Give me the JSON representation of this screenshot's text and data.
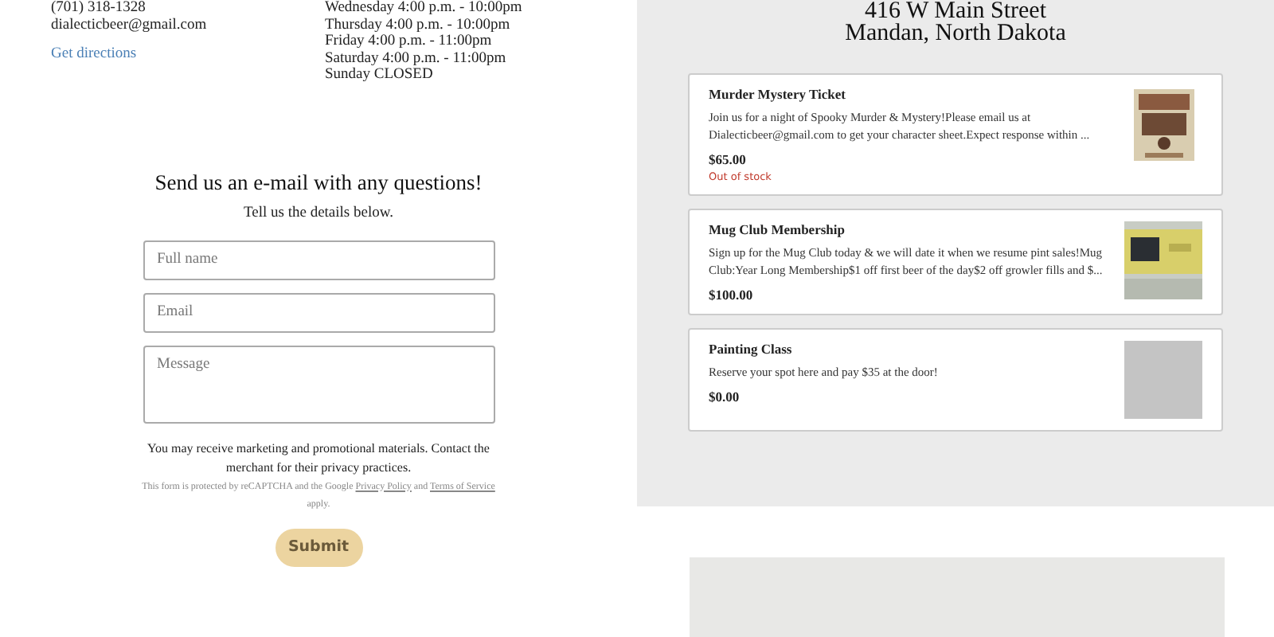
{
  "contact": {
    "phone": "(701) 318-1328",
    "email": "dialecticbeer@gmail.com",
    "directions_link": "Get directions"
  },
  "hours": [
    "Wednesday 4:00 p.m. - 10:00pm",
    "Thursday 4:00 p.m. - 10:00pm",
    "Friday 4:00 p.m. - 11:00pm",
    "Saturday 4:00 p.m. - 11:00pm",
    "Sunday CLOSED"
  ],
  "form": {
    "heading": "Send us an e-mail with any questions!",
    "subheading": "Tell us the details below.",
    "fields": [
      {
        "kind": "line",
        "placeholder": "Full name"
      },
      {
        "kind": "line",
        "placeholder": "Email"
      },
      {
        "kind": "area",
        "placeholder": "Message"
      }
    ],
    "consent": "You may receive marketing and promotional materials. Contact the merchant for their privacy practices.",
    "recaptcha": {
      "before": "This form is protected by reCAPTCHA and the Google",
      "privacy_link": "Privacy Policy",
      "and": "and",
      "terms_link": "Terms of Service",
      "after": "apply."
    },
    "submit": "Submit"
  },
  "address": [
    "416 W Main Street",
    "Mandan, North Dakota"
  ],
  "products": [
    {
      "title": "Murder Mystery Ticket",
      "description": "Join us for a night of Spooky Murder & Mystery!Please email us at Dialecticbeer@gmail.com to get your character sheet.Expect response within ...",
      "price": "$65.00",
      "stock_note": "Out of stock",
      "kind": "picture"
    },
    {
      "title": "Mug Club Membership",
      "description": "Sign up for the Mug Club today & we will date it when we resume pint sales!Mug Club:Year Long Membership$1 off first beer of the day$2 off growler fills and $...",
      "price": "$100.00",
      "kind": "picture"
    },
    {
      "title": "Painting Class",
      "description": "Reserve your spot here and pay $35 at the door!",
      "price": "$0.00",
      "kind": "placeholder"
    }
  ]
}
